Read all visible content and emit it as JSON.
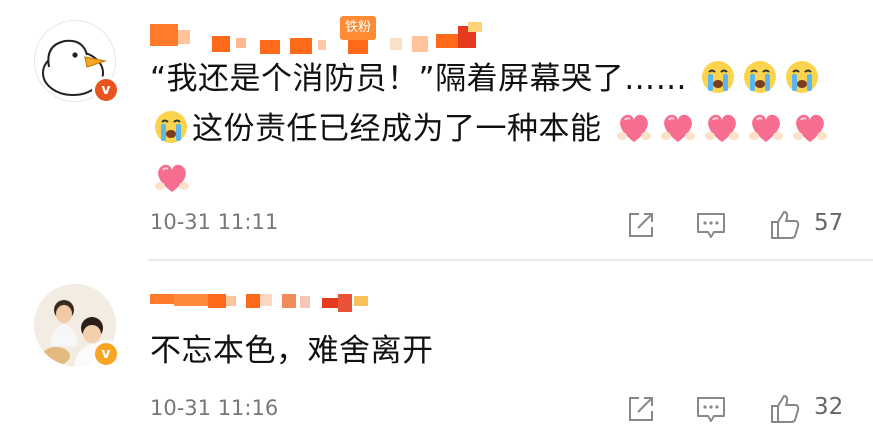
{
  "comments": [
    {
      "nickname": "",
      "fan_badge": "铁粉",
      "text_parts": [
        "“我还是个消防员！”隔着屏幕哭了……",
        "这份责任已经成为了一种本能"
      ],
      "timestamp": "10-31 11:11",
      "likes": "57",
      "verified": true,
      "avatar": "goose-avatar"
    },
    {
      "nickname": "",
      "text": "不忘本色，难舍离开",
      "timestamp": "10-31 11:16",
      "likes": "32",
      "verified": true,
      "avatar": "child-photo-avatar"
    }
  ],
  "icons": {
    "crying": "loudly-crying-face-icon",
    "heart": "heart-hands-icon",
    "share": "share-icon",
    "comment": "comment-icon",
    "like": "thumbs-up-icon"
  },
  "colors": {
    "accent": "#ff8a34",
    "badge_gold": "#f6a623",
    "badge_red": "#e8531f",
    "meta_text": "#777777",
    "icon_gray": "#888888"
  }
}
